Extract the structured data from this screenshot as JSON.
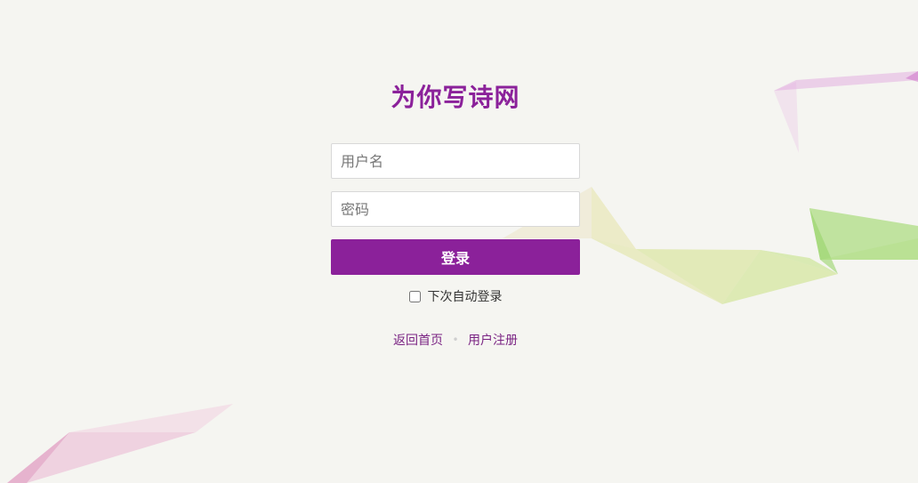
{
  "site": {
    "title": "为你写诗网"
  },
  "form": {
    "username_placeholder": "用户名",
    "username_value": "",
    "password_placeholder": "密码",
    "password_value": "",
    "submit_label": "登录",
    "remember_label": "下次自动登录",
    "remember_checked": false
  },
  "links": {
    "home_label": "返回首页",
    "separator": "•",
    "register_label": "用户注册"
  },
  "colors": {
    "brand": "#8b219a",
    "background": "#f5f5f1",
    "link": "#7a2383"
  }
}
